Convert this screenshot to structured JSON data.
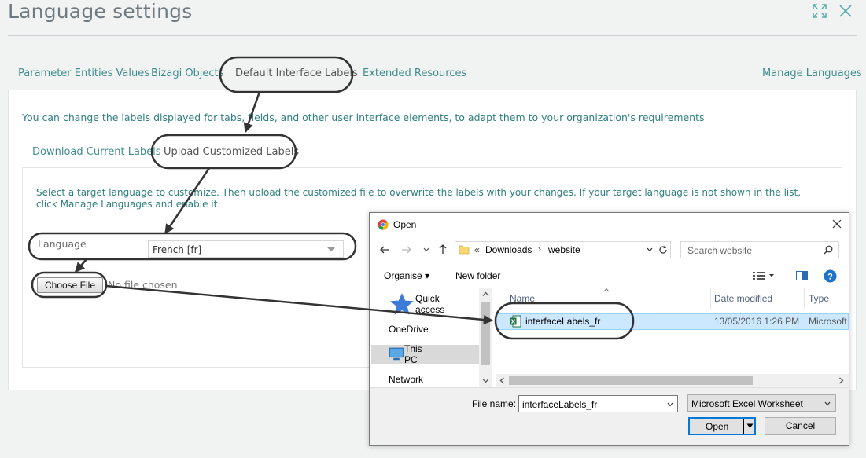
{
  "page": {
    "title": "Language settings"
  },
  "tabs": [
    {
      "label": "Parameter Entities Values"
    },
    {
      "label": "Bizagi Objects"
    },
    {
      "label": "Default Interface Labels"
    },
    {
      "label": "Extended Resources"
    }
  ],
  "manage_languages": "Manage Languages",
  "intro": "You can change the labels displayed for tabs, fields, and other user interface elements, to adapt them to your organization's requirements",
  "subtabs": [
    {
      "label": "Download Current Labels"
    },
    {
      "label": "Upload Customized Labels"
    }
  ],
  "upload": {
    "instructions": "Select a target language to customize. Then upload the customized file to overwrite the labels with your changes. If your target language is not shown in the list, click Manage Languages and enable it.",
    "language_label": "Language",
    "language_value": "French [fr]",
    "choose_file": "Choose File",
    "no_file": "No file chosen"
  },
  "dialog": {
    "title": "Open",
    "path_prefix": "«",
    "path_folder1": "Downloads",
    "path_sep": "›",
    "path_folder2": "website",
    "search_placeholder": "Search website",
    "organise": "Organise ▾",
    "new_folder": "New folder",
    "nav": [
      {
        "label": "Quick access"
      },
      {
        "label": "OneDrive"
      },
      {
        "label": "This PC"
      },
      {
        "label": "Network"
      }
    ],
    "columns": {
      "name": "Name",
      "date": "Date modified",
      "type": "Type"
    },
    "file": {
      "name": "interfaceLabels_fr",
      "date": "13/05/2016 1:26 PM",
      "type": "Microsoft"
    },
    "file_name_label": "File name:",
    "file_name_value": "interfaceLabels_fr",
    "file_type": "Microsoft Excel Worksheet",
    "open_button": "Open",
    "cancel_button": "Cancel"
  },
  "colors": {
    "teal": "#3f8d8d",
    "highlight": "#cce8ff",
    "accent": "#0078d7"
  }
}
